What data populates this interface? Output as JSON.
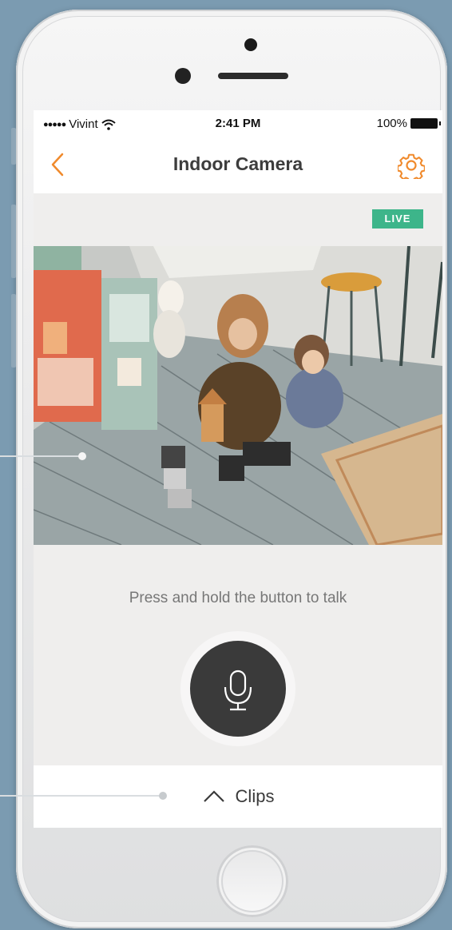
{
  "status_bar": {
    "carrier_signal": "●●●●●",
    "carrier": "Vivint",
    "time": "2:41 PM",
    "battery": "100%"
  },
  "nav": {
    "title": "Indoor Camera",
    "back_icon": "chevron-left-icon",
    "settings_icon": "gear-icon"
  },
  "live_badge": "LIVE",
  "talk": {
    "hint": "Press and hold the button to talk",
    "mic_icon": "microphone-icon"
  },
  "clips": {
    "label": "Clips",
    "icon": "chevron-up-icon"
  },
  "colors": {
    "accent": "#f08a2c",
    "live": "#3db58a",
    "mic_button": "#3a3a3a"
  }
}
